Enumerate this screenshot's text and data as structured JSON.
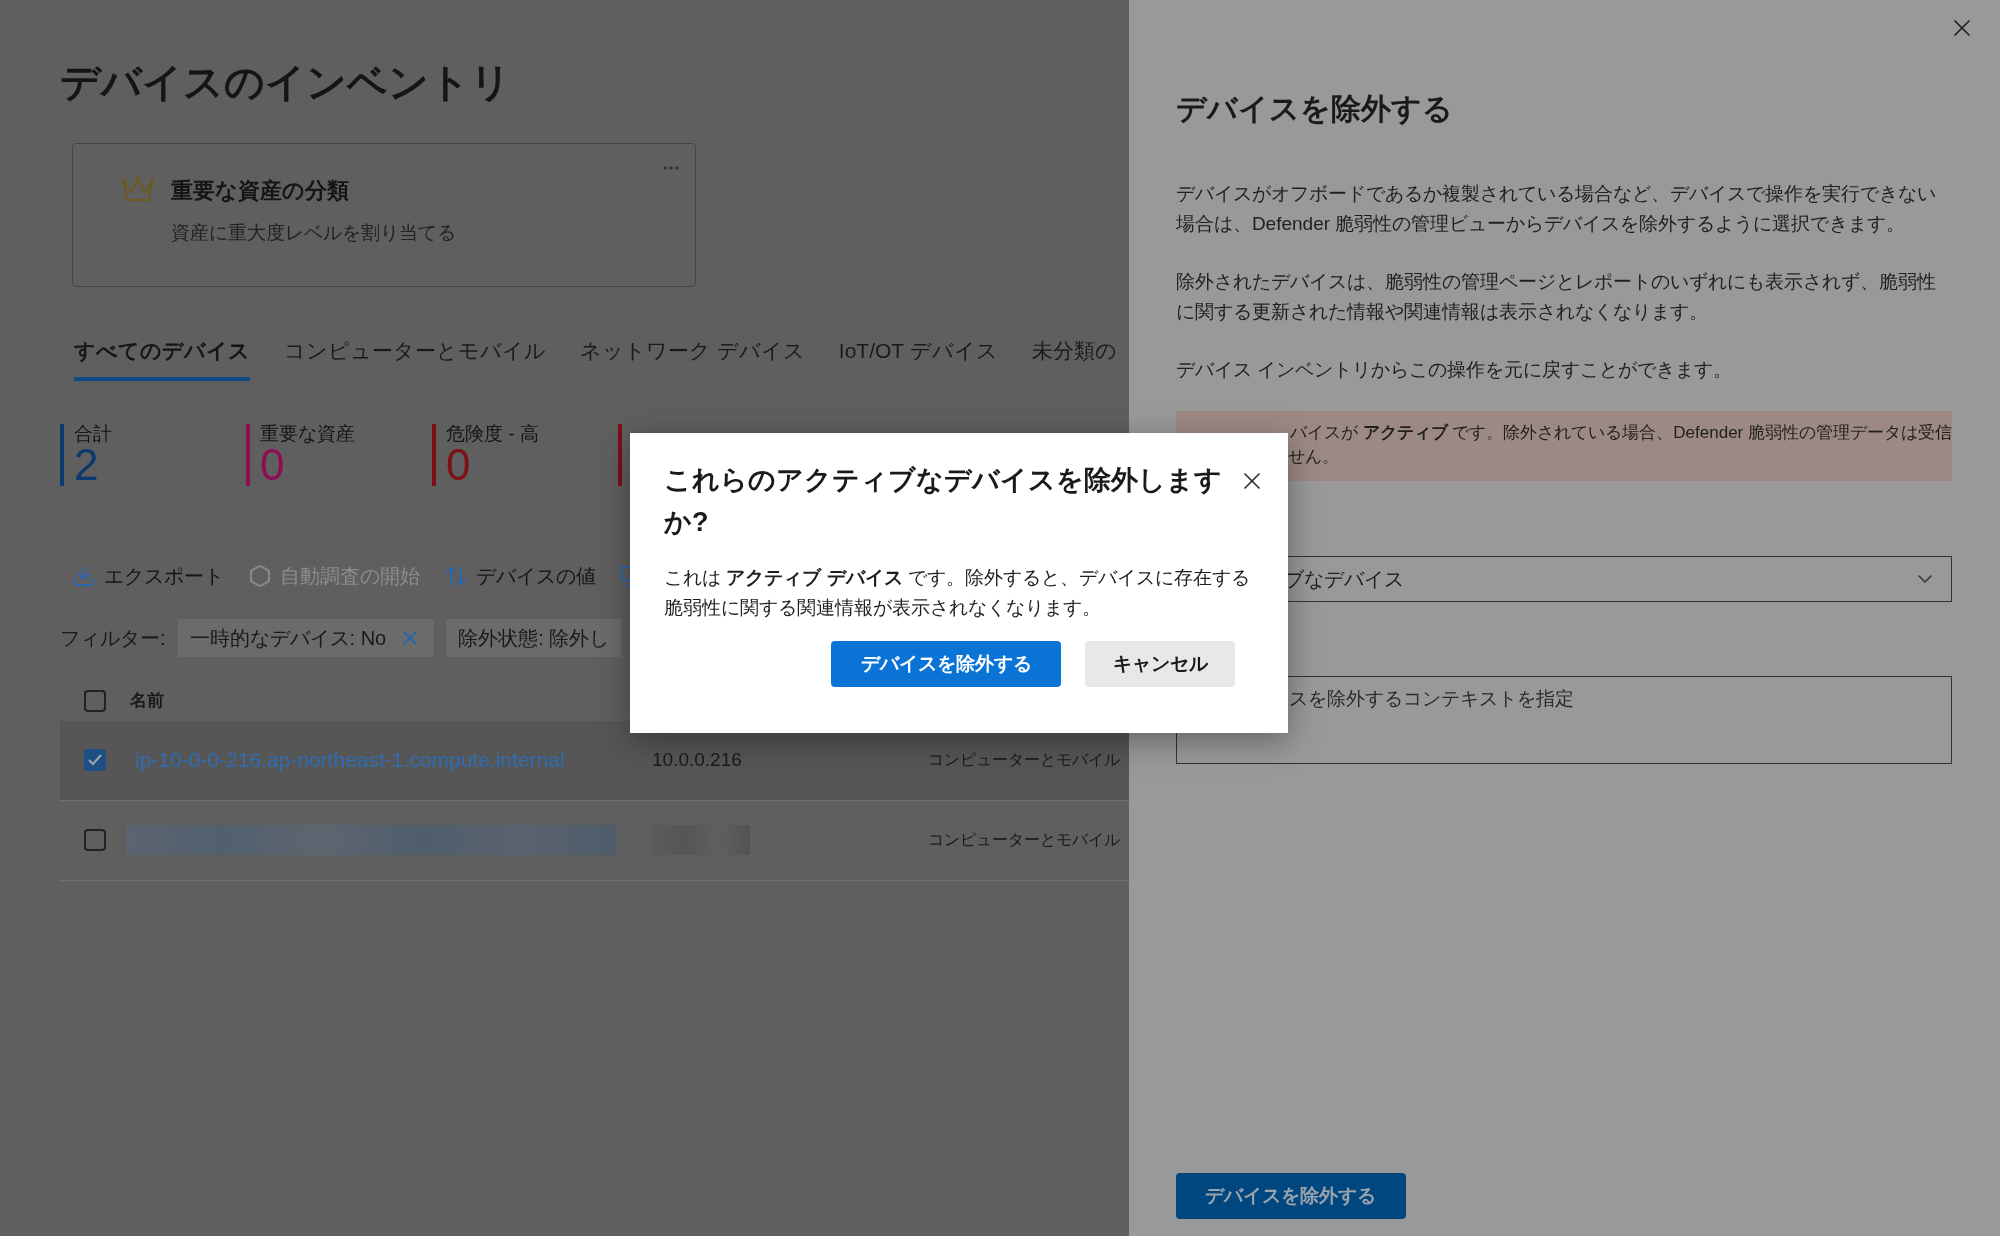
{
  "page": {
    "title": "デバイスのインベントリ"
  },
  "card": {
    "title": "重要な資産の分類",
    "subtitle": "資産に重大度レベルを割り当てる"
  },
  "tabs": [
    {
      "label": "すべてのデバイス",
      "selected": true
    },
    {
      "label": "コンピューターとモバイル",
      "selected": false
    },
    {
      "label": "ネットワーク デバイス",
      "selected": false
    },
    {
      "label": "IoT/OT デバイス",
      "selected": false
    },
    {
      "label": "未分類の",
      "selected": false
    }
  ],
  "metrics": [
    {
      "label": "合計",
      "value": "2",
      "color": "#0b3a6e"
    },
    {
      "label": "重要な資産",
      "value": "0",
      "color": "#8c0f55"
    },
    {
      "label": "危険度 - 高",
      "value": "0",
      "color": "#7c1016"
    },
    {
      "color": "#7c1016"
    }
  ],
  "toolbar": [
    {
      "kind": "export",
      "label": "エクスポート",
      "disabled": false
    },
    {
      "kind": "investigate",
      "label": "自動調査の開始",
      "disabled": true
    },
    {
      "kind": "value",
      "label": "デバイスの値",
      "disabled": false
    },
    {
      "kind": "monitor"
    }
  ],
  "filters": {
    "label": "フィルター:",
    "chips": [
      {
        "text": "一時的なデバイス: No",
        "removable": true
      },
      {
        "text": "除外状態: 除外し",
        "removable": false
      }
    ]
  },
  "table": {
    "header_checked": false,
    "columns": [
      "名前"
    ],
    "rows": [
      {
        "selected": true,
        "name": "ip-10-0-0-216.ap-northeast-1.compute.internal",
        "ip": "10.0.0.216",
        "type": "コンピューターとモバイル"
      },
      {
        "selected": false,
        "kind": "redacted",
        "type": "コンピューターとモバイル"
      }
    ]
  },
  "panel": {
    "title": "デバイスを除外する",
    "paragraphs": [
      "デバイスがオフボードであるか複製されている場合など、デバイスで操作を実行できない場合は、Defender 脆弱性の管理ビューからデバイスを除外するように選択できます。",
      "除外されたデバイスは、脆弱性の管理ページとレポートのいずれにも表示されず、脆弱性に関する更新された情報や関連情報は表示されなくなります。",
      "デバイス インベントリからこの操作を元に戻すことができます。"
    ],
    "warning": [
      "バイスが **アクティブ** です。除外されている場合、Defender 脆弱性の管理データは受信",
      "せん。"
    ],
    "dropdown": {
      "value": "ブなデバイス"
    },
    "textarea": {
      "placeholder": "スを除外するコンテキストを指定"
    },
    "submit": "デバイスを除外する"
  },
  "dialog": {
    "title": "これらのアクティブなデバイスを除外しますか?",
    "body": "これは **アクティブ デバイス** です。除外すると、デバイスに存在する脆弱性に関する関連情報が表示されなくなります。",
    "primary": "デバイスを除外する",
    "secondary": "キャンセル"
  }
}
